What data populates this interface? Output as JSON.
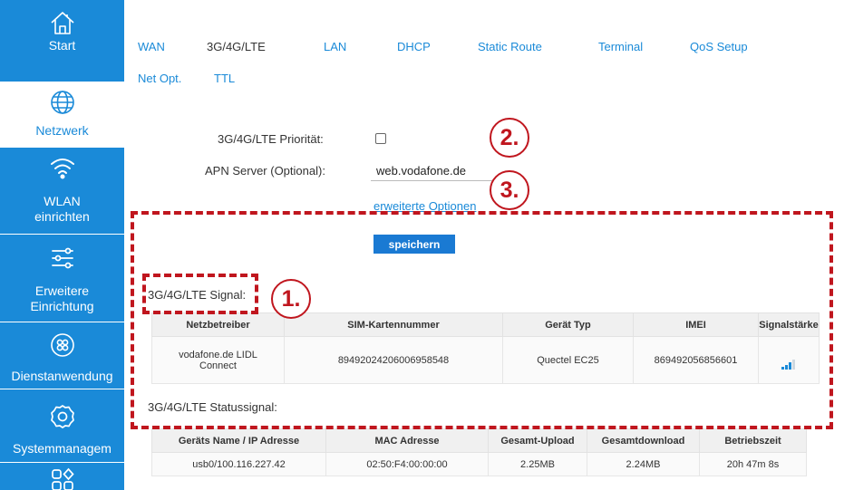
{
  "sidebar": {
    "items": [
      {
        "label": "Start",
        "icon": "home-icon"
      },
      {
        "label": "Netzwerk",
        "icon": "globe-icon",
        "active": true
      },
      {
        "label": "WLAN\neinrichten",
        "icon": "wifi-icon"
      },
      {
        "label": "Erweitere\nEinrichtung",
        "icon": "sliders-icon"
      },
      {
        "label": "Dienstanwendung",
        "icon": "apps-icon"
      },
      {
        "label": "Systemmanagem",
        "icon": "gear-icon"
      },
      {
        "label": "",
        "icon": "shapes-icon"
      }
    ]
  },
  "tabs": [
    {
      "label": "WAN"
    },
    {
      "label": "3G/4G/LTE",
      "active": true
    },
    {
      "label": "LAN"
    },
    {
      "label": "DHCP"
    },
    {
      "label": "Static Route"
    },
    {
      "label": "Terminal"
    },
    {
      "label": "QoS Setup"
    },
    {
      "label": "Net Opt."
    },
    {
      "label": "TTL"
    }
  ],
  "form": {
    "priority_label": "3G/4G/LTE Priorität:",
    "priority_checked": false,
    "apn_label": "APN Server (Optional):",
    "apn_value": "web.vodafone.de",
    "advanced_link": "erweiterte Optionen",
    "save_label": "speichern"
  },
  "signal": {
    "title": "3G/4G/LTE Signal:",
    "headers": [
      "Netzbetreiber",
      "SIM-Kartennummer",
      "Gerät Typ",
      "IMEI",
      "Signalstärke"
    ],
    "row": [
      "vodafone.de LIDL\nConnect",
      "89492024206006958548",
      "Quectel EC25",
      "869492056856601"
    ],
    "signal_icon": "signal-bars-icon",
    "signal_level": 0.75
  },
  "status": {
    "title": "3G/4G/LTE Statussignal:",
    "headers": [
      "Geräts Name / IP Adresse",
      "MAC Adresse",
      "Gesamt-Upload",
      "Gesamtdownload",
      "Betriebszeit"
    ],
    "row": [
      "usb0/100.116.227.42",
      "02:50:F4:00:00:00",
      "2.25MB",
      "2.24MB",
      "20h 47m 8s"
    ]
  },
  "annotations": {
    "color": "#c0161e",
    "callouts": [
      "1.",
      "2.",
      "3."
    ]
  },
  "colors": {
    "sidebar_bg": "#1a8ad8",
    "link": "#1a8ad8",
    "button": "#1a7ad3",
    "annotation": "#c0161e"
  }
}
